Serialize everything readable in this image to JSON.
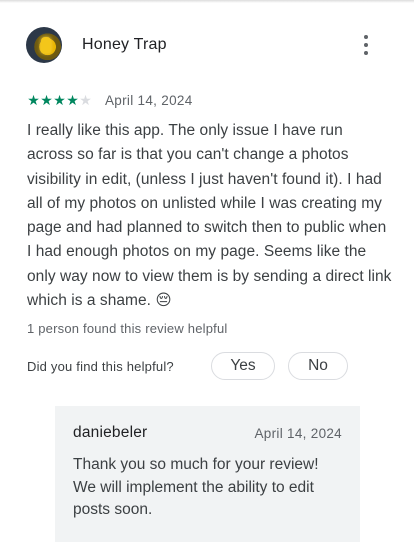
{
  "review": {
    "reviewer_name": "Honey Trap",
    "rating": 4,
    "max_rating": 5,
    "date": "April 14, 2024",
    "body": "I really like this app. The only issue I have run across so far is that you can't change a photos visibility in edit, (unless I just haven't found it). I had all of my photos on unlisted while I was creating my page and had planned to switch then to public when I had enough photos on my page. Seems like the only way now to view them is by sending a direct link which is a shame. 😔",
    "helpful_count_text": "1 person found this review helpful",
    "helpful_question": "Did you find this helpful?",
    "yes_label": "Yes",
    "no_label": "No"
  },
  "reply": {
    "author": "daniebeler",
    "date": "April 14, 2024",
    "body": "Thank you so much for your review! We will implement the ability to edit posts soon."
  },
  "colors": {
    "star_filled": "#01875f",
    "star_empty": "#dadce0",
    "reply_background": "#f1f3f4"
  },
  "icons": {
    "more": "more-vert-icon",
    "star": "star-icon"
  }
}
